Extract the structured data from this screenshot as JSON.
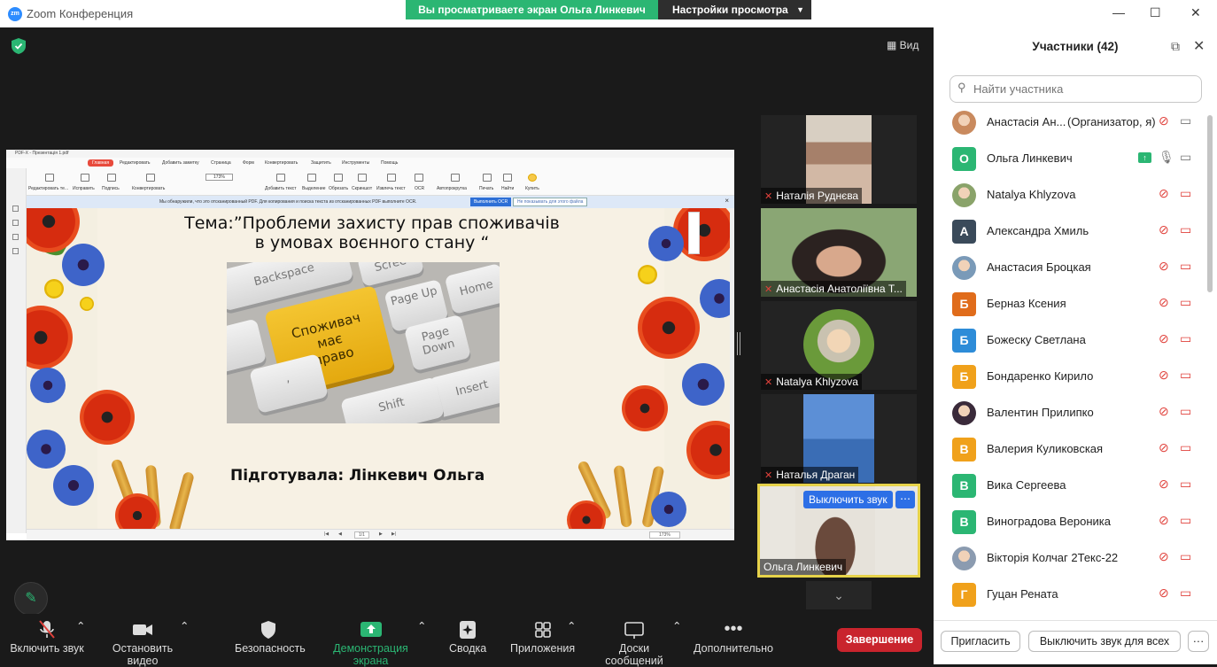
{
  "window": {
    "app_title": "Zoom Конференция",
    "logo_text": "zm",
    "share_banner": "Вы просматриваете экран Ольга Линкевич",
    "view_settings": "Настройки просмотра",
    "view_button": "Вид"
  },
  "pdf": {
    "title": "PDF-X - Презентація 1.pdf",
    "menu": [
      "Главная",
      "Редактировать",
      "Добавить заметку",
      "Страница",
      "Форм",
      "Конвертировать",
      "Защитить",
      "Инструменты",
      "Помощь"
    ],
    "toolbar": [
      "Редактировать те...",
      "Исправить",
      "Подпись",
      "Конвертировать",
      "Добавить текст",
      "Выделение",
      "Обрезать",
      "Скриншот",
      "Извлечь текст",
      "OCR",
      "Автопрокрутка",
      "Печать",
      "Найти",
      "Купить"
    ],
    "zoom": "173%",
    "ocr_message": "Мы обнаружили, что это отсканированный PDF. Для копирования и поиска текста из отсканированных PDF выполните OCR.",
    "ocr_button": "Выполнить OCR",
    "ocr_ignore": "Не показывать для этого файла",
    "page_indicator": "1/1",
    "status_zoom": "173%"
  },
  "slide": {
    "title": "Тема:”Проблеми захисту прав споживачів в умовах воєнного стану “",
    "author": "Підготувала: Лінкевич Ольга",
    "keys": {
      "main": "Споживач має право",
      "backspace": "Backspace",
      "screen": "Scree",
      "page_up": "Page Up",
      "home": "Home",
      "page_down": "Page Down",
      "insert": "Insert",
      "shift": "Shift",
      "comma": ","
    }
  },
  "tiles": [
    {
      "name": "Наталія Руднєва",
      "muted": true
    },
    {
      "name": "Анастасія Анатоліївна Т...",
      "muted": true
    },
    {
      "name": "Natalya Khlyzova",
      "muted": true
    },
    {
      "name": "Наталья Драган",
      "muted": true
    },
    {
      "name": "Ольга Линкевич",
      "muted": false
    }
  ],
  "tile_mute_button": "Выключить звук",
  "toolbar": {
    "mute": "Включить звук",
    "video": "Остановить видео",
    "security": "Безопасность",
    "share": "Демонстрация экрана",
    "summary": "Сводка",
    "apps": "Приложения",
    "whiteboards": "Доски сообщений",
    "more": "Дополнительно",
    "end": "Завершение"
  },
  "panel": {
    "title": "Участники (42)",
    "search_placeholder": "Найти участника",
    "invite": "Пригласить",
    "mute_all": "Выключить звук для всех",
    "more": "···"
  },
  "participants": [
    {
      "name": "Анастасія Ан...",
      "role": "(Организатор, я)",
      "initial": "",
      "color": "#c98a5e",
      "photo": true
    },
    {
      "name": "Ольга Линкевич",
      "initial": "О",
      "color": "#2bb673",
      "sharing": true
    },
    {
      "name": "Natalya Khlyzova",
      "initial": "",
      "color": "#8aa36a",
      "photo": true
    },
    {
      "name": "Александра Хмиль",
      "initial": "А",
      "color": "#3a4a5a"
    },
    {
      "name": "Анастасия Броцкая",
      "initial": "",
      "color": "#7a9ab8",
      "photo": true
    },
    {
      "name": "Берназ Ксения",
      "initial": "Б",
      "color": "#e06c1b"
    },
    {
      "name": "Божеску Светлана",
      "initial": "Б",
      "color": "#2d8cd8"
    },
    {
      "name": "Бондаренко Кирило",
      "initial": "Б",
      "color": "#f0a11b"
    },
    {
      "name": "Валентин Прилипко",
      "initial": "",
      "color": "#3a2a3a",
      "photo": true
    },
    {
      "name": "Валерия Куликовская",
      "initial": "В",
      "color": "#f0a11b"
    },
    {
      "name": "Вика Сергеева",
      "initial": "В",
      "color": "#2bb673"
    },
    {
      "name": "Виноградова Вероника",
      "initial": "В",
      "color": "#2bb673"
    },
    {
      "name": "Вікторія Колчаг 2Текс-22",
      "initial": "",
      "color": "#8b9bb0",
      "photo": true
    },
    {
      "name": "Гуцан Рената",
      "initial": "Г",
      "color": "#f0a11b"
    }
  ]
}
